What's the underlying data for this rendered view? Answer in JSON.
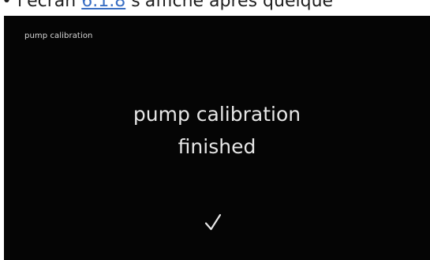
{
  "doc_caption": {
    "prefix": "• l'écran",
    "link": "6.1.8",
    "suffix": "s'affiche après quelque"
  },
  "screen": {
    "header_title": "pump calibration",
    "message_line1": "pump calibration",
    "message_line2": "finished",
    "confirm_icon": "check-icon"
  },
  "colors": {
    "screen_background": "#050505",
    "text": "#e6e6e6",
    "link": "#3a6fc4"
  }
}
